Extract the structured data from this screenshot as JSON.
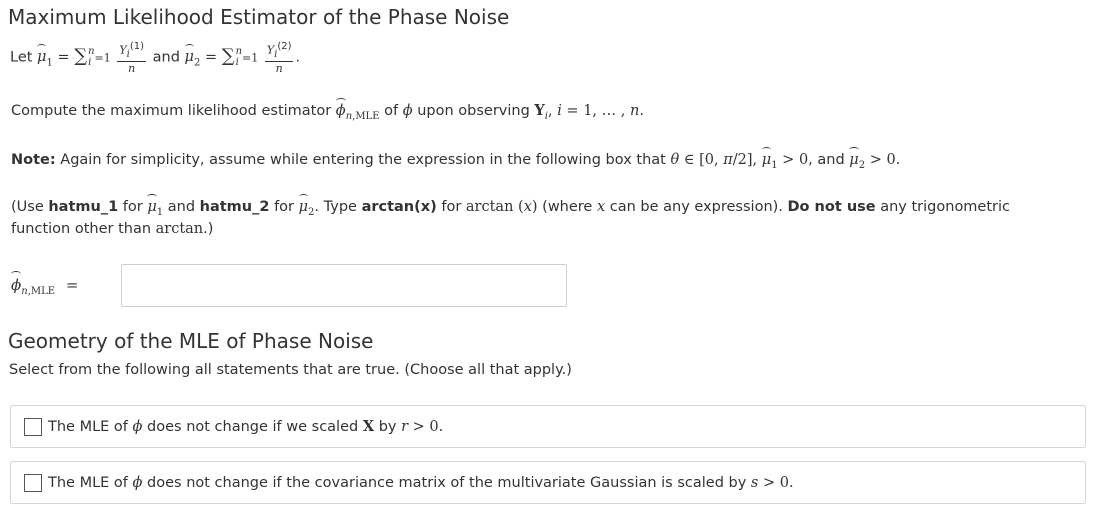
{
  "section1": {
    "title": "Maximum Likelihood Estimator of the Phase Noise",
    "let_word": "Let",
    "and_word": "and",
    "compute_prefix": "Compute the maximum likelihood estimator",
    "compute_of": "of",
    "compute_upon": "upon observing",
    "note_label": "Note:",
    "note_text": "Again for simplicity, assume while entering the expression in the following box that",
    "note_and": ", and",
    "use_open": "(Use",
    "hatmu1_code": "hatmu_1",
    "for_word": "for",
    "and_word2": "and",
    "hatmu2_code": "hatmu_2",
    "type_text": ". Type",
    "arctan_code": "arctan(x)",
    "where_text": "(where",
    "can_be": "can be any expression).",
    "do_not_use": "Do not use",
    "any_trig": "any trigonometric",
    "line2": "function other than",
    "line2_end": ".)",
    "answer_label_eq": "=",
    "answer_value": "",
    "answer_placeholder": ""
  },
  "section2": {
    "title": "Geometry of the MLE of Phase Noise",
    "instructions": "Select from the following all statements that are true. (Choose all that apply.)",
    "choices": [
      {
        "prefix": "The MLE of",
        "mid": "does not change if we scaled",
        "mid2": "by",
        "checked": false
      },
      {
        "prefix": "The MLE of",
        "mid": "does not change if the covariance matrix of the multivariate Gaussian is scaled by",
        "checked": false
      }
    ]
  }
}
